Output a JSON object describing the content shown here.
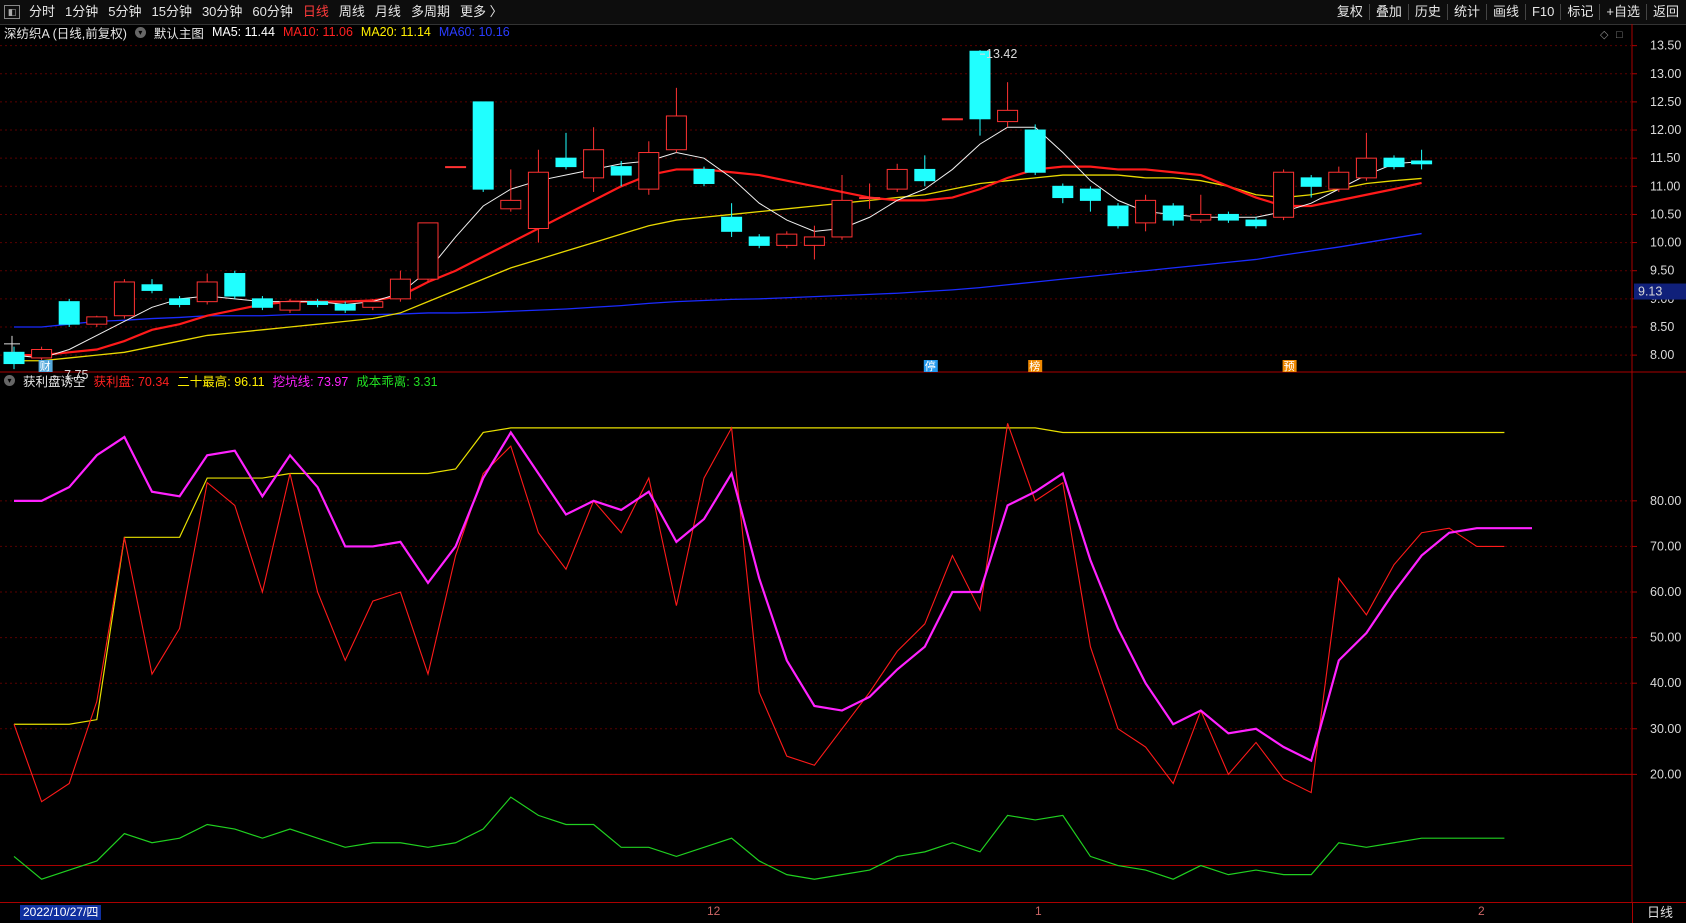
{
  "toolbar": {
    "left_items": [
      "分时",
      "1分钟",
      "5分钟",
      "15分钟",
      "30分钟",
      "60分钟",
      "日线",
      "周线",
      "月线",
      "多周期",
      "更多 〉"
    ],
    "active_item": "日线",
    "right_items": [
      "复权",
      "叠加",
      "历史",
      "统计",
      "画线",
      "F10",
      "标记",
      "+自选",
      "返回"
    ]
  },
  "main_pane": {
    "title": "深纺织A (日线,前复权)",
    "indicator_name": "默认主图",
    "ma": [
      {
        "label": "MA5: 11.44",
        "color": "#ffffff"
      },
      {
        "label": "MA10: 11.06",
        "color": "#ff2020"
      },
      {
        "label": "MA20: 11.14",
        "color": "#ffee00"
      },
      {
        "label": "MA60: 10.16",
        "color": "#2a3cff"
      }
    ],
    "y_ticks": [
      "13.50",
      "13.00",
      "12.50",
      "12.00",
      "11.50",
      "11.00",
      "10.50",
      "10.00",
      "9.50",
      "9.00",
      "8.50",
      "8.00"
    ],
    "price_tag": "9.13",
    "high_label": "13.42",
    "low_label": "7.75",
    "event_labels": [
      "财",
      "停",
      "榜",
      "预"
    ]
  },
  "indicator_pane": {
    "name": "获利盘诱空",
    "values": [
      {
        "label": "获利盘: 70.34",
        "color": "#ff2020"
      },
      {
        "label": "二十最高: 96.11",
        "color": "#ffee00"
      },
      {
        "label": "挖坑线: 73.97",
        "color": "#ff22ff"
      },
      {
        "label": "成本乖离: 3.31",
        "color": "#22dd22"
      }
    ],
    "y_ticks": [
      "80.00",
      "70.00",
      "60.00",
      "50.00",
      "40.00",
      "30.00",
      "20.00"
    ]
  },
  "bottom_axis": {
    "date_badge": "2022/10/27/四",
    "month_ticks": [
      "12",
      "1",
      "2"
    ],
    "period_label": "日线"
  },
  "candles": [
    {
      "o": 8.05,
      "c": 7.85,
      "h": 8.15,
      "l": 7.75
    },
    {
      "o": 7.95,
      "c": 8.1,
      "h": 8.15,
      "l": 7.9
    },
    {
      "o": 8.95,
      "c": 8.55,
      "h": 9.0,
      "l": 8.5
    },
    {
      "o": 8.55,
      "c": 8.68,
      "h": 8.7,
      "l": 8.5
    },
    {
      "o": 8.7,
      "c": 9.3,
      "h": 9.35,
      "l": 8.65
    },
    {
      "o": 9.25,
      "c": 9.15,
      "h": 9.35,
      "l": 9.1
    },
    {
      "o": 9.0,
      "c": 8.9,
      "h": 9.05,
      "l": 8.85
    },
    {
      "o": 8.95,
      "c": 9.3,
      "h": 9.45,
      "l": 8.9
    },
    {
      "o": 9.45,
      "c": 9.05,
      "h": 9.5,
      "l": 9.0
    },
    {
      "o": 9.0,
      "c": 8.85,
      "h": 9.05,
      "l": 8.8
    },
    {
      "o": 8.8,
      "c": 8.95,
      "h": 9.0,
      "l": 8.75
    },
    {
      "o": 8.95,
      "c": 8.9,
      "h": 9.0,
      "l": 8.85
    },
    {
      "o": 8.9,
      "c": 8.8,
      "h": 8.95,
      "l": 8.75
    },
    {
      "o": 8.85,
      "c": 8.95,
      "h": 9.0,
      "l": 8.8
    },
    {
      "o": 9.0,
      "c": 9.35,
      "h": 9.5,
      "l": 8.95
    },
    {
      "o": 9.35,
      "c": 10.35,
      "h": 10.35,
      "l": 9.3
    },
    {
      "o": 11.35,
      "c": 11.35,
      "h": 11.35,
      "l": 11.35
    },
    {
      "o": 12.5,
      "c": 10.95,
      "h": 12.5,
      "l": 10.9
    },
    {
      "o": 10.6,
      "c": 10.75,
      "h": 11.3,
      "l": 10.55
    },
    {
      "o": 10.25,
      "c": 11.25,
      "h": 11.65,
      "l": 10.0
    },
    {
      "o": 11.5,
      "c": 11.35,
      "h": 11.95,
      "l": 11.3
    },
    {
      "o": 11.15,
      "c": 11.65,
      "h": 12.05,
      "l": 10.9
    },
    {
      "o": 11.35,
      "c": 11.2,
      "h": 11.45,
      "l": 11.0
    },
    {
      "o": 10.95,
      "c": 11.6,
      "h": 11.8,
      "l": 10.85
    },
    {
      "o": 11.65,
      "c": 12.25,
      "h": 12.75,
      "l": 11.6
    },
    {
      "o": 11.3,
      "c": 11.05,
      "h": 11.35,
      "l": 11.0
    },
    {
      "o": 10.45,
      "c": 10.2,
      "h": 10.7,
      "l": 10.1
    },
    {
      "o": 10.1,
      "c": 9.95,
      "h": 10.15,
      "l": 9.9
    },
    {
      "o": 9.95,
      "c": 10.15,
      "h": 10.2,
      "l": 9.9
    },
    {
      "o": 9.95,
      "c": 10.1,
      "h": 10.3,
      "l": 9.7
    },
    {
      "o": 10.1,
      "c": 10.75,
      "h": 11.2,
      "l": 10.05
    },
    {
      "o": 10.8,
      "c": 10.8,
      "h": 11.05,
      "l": 10.6
    },
    {
      "o": 10.95,
      "c": 11.3,
      "h": 11.4,
      "l": 10.9
    },
    {
      "o": 11.3,
      "c": 11.1,
      "h": 11.55,
      "l": 11.0
    },
    {
      "o": 12.2,
      "c": 12.2,
      "h": 12.2,
      "l": 12.2
    },
    {
      "o": 13.4,
      "c": 12.2,
      "h": 13.42,
      "l": 11.9
    },
    {
      "o": 12.15,
      "c": 12.35,
      "h": 12.85,
      "l": 12.05
    },
    {
      "o": 12.0,
      "c": 11.25,
      "h": 12.1,
      "l": 11.2
    },
    {
      "o": 11.0,
      "c": 10.8,
      "h": 11.05,
      "l": 10.7
    },
    {
      "o": 10.95,
      "c": 10.75,
      "h": 11.0,
      "l": 10.55
    },
    {
      "o": 10.65,
      "c": 10.3,
      "h": 10.7,
      "l": 10.25
    },
    {
      "o": 10.35,
      "c": 10.75,
      "h": 10.85,
      "l": 10.2
    },
    {
      "o": 10.65,
      "c": 10.4,
      "h": 10.7,
      "l": 10.3
    },
    {
      "o": 10.4,
      "c": 10.5,
      "h": 10.85,
      "l": 10.35
    },
    {
      "o": 10.5,
      "c": 10.4,
      "h": 10.55,
      "l": 10.35
    },
    {
      "o": 10.4,
      "c": 10.3,
      "h": 10.45,
      "l": 10.25
    },
    {
      "o": 10.45,
      "c": 11.25,
      "h": 11.3,
      "l": 10.4
    },
    {
      "o": 11.15,
      "c": 11.0,
      "h": 11.2,
      "l": 10.8
    },
    {
      "o": 10.95,
      "c": 11.25,
      "h": 11.35,
      "l": 10.9
    },
    {
      "o": 11.15,
      "c": 11.5,
      "h": 11.95,
      "l": 11.1
    },
    {
      "o": 11.5,
      "c": 11.35,
      "h": 11.55,
      "l": 11.3
    },
    {
      "o": 11.45,
      "c": 11.4,
      "h": 11.65,
      "l": 11.3
    }
  ],
  "ma_lines": {
    "ma5": [
      8.0,
      7.95,
      8.1,
      8.35,
      8.6,
      8.85,
      9.0,
      9.05,
      9.0,
      8.95,
      8.95,
      8.95,
      8.9,
      8.95,
      9.1,
      9.5,
      10.1,
      10.65,
      10.95,
      11.1,
      11.2,
      11.3,
      11.4,
      11.45,
      11.6,
      11.5,
      11.15,
      10.7,
      10.4,
      10.2,
      10.25,
      10.45,
      10.75,
      10.95,
      11.3,
      11.75,
      12.05,
      12.05,
      11.6,
      11.1,
      10.75,
      10.55,
      10.5,
      10.45,
      10.45,
      10.45,
      10.55,
      10.7,
      10.95,
      11.2,
      11.4,
      11.44
    ],
    "ma10": [
      8.0,
      8.0,
      8.05,
      8.1,
      8.25,
      8.45,
      8.55,
      8.7,
      8.8,
      8.9,
      8.95,
      8.95,
      8.95,
      8.97,
      9.05,
      9.3,
      9.5,
      9.75,
      10.0,
      10.25,
      10.5,
      10.75,
      11.0,
      11.2,
      11.3,
      11.3,
      11.25,
      11.2,
      11.1,
      11.0,
      10.9,
      10.8,
      10.75,
      10.75,
      10.8,
      10.95,
      11.15,
      11.3,
      11.35,
      11.35,
      11.3,
      11.3,
      11.25,
      11.2,
      11.0,
      10.8,
      10.65,
      10.65,
      10.75,
      10.85,
      10.95,
      11.06
    ],
    "ma20": [
      7.9,
      7.9,
      7.95,
      8.0,
      8.05,
      8.15,
      8.25,
      8.35,
      8.4,
      8.45,
      8.5,
      8.55,
      8.6,
      8.65,
      8.75,
      8.95,
      9.15,
      9.35,
      9.55,
      9.7,
      9.85,
      10.0,
      10.15,
      10.3,
      10.4,
      10.45,
      10.5,
      10.55,
      10.6,
      10.65,
      10.7,
      10.75,
      10.8,
      10.85,
      10.95,
      11.05,
      11.1,
      11.15,
      11.2,
      11.2,
      11.2,
      11.15,
      11.15,
      11.1,
      11.0,
      10.85,
      10.8,
      10.85,
      10.95,
      11.05,
      11.1,
      11.14
    ],
    "ma60": [
      8.5,
      8.5,
      8.55,
      8.6,
      8.62,
      8.65,
      8.67,
      8.7,
      8.7,
      8.7,
      8.72,
      8.72,
      8.72,
      8.72,
      8.73,
      8.75,
      8.75,
      8.76,
      8.78,
      8.8,
      8.82,
      8.85,
      8.88,
      8.92,
      8.95,
      8.97,
      8.99,
      9.0,
      9.02,
      9.04,
      9.06,
      9.08,
      9.1,
      9.13,
      9.16,
      9.2,
      9.25,
      9.3,
      9.35,
      9.4,
      9.45,
      9.5,
      9.55,
      9.6,
      9.65,
      9.7,
      9.78,
      9.85,
      9.92,
      10.0,
      10.08,
      10.16
    ]
  },
  "indicator_series": {
    "profit": [
      31,
      14,
      18,
      36,
      72,
      42,
      52,
      84,
      79,
      60,
      86,
      60,
      45,
      58,
      60,
      42,
      68,
      86,
      92,
      73,
      65,
      80,
      73,
      85,
      57,
      85,
      96,
      38,
      24,
      22,
      30,
      38,
      47,
      53,
      68,
      56,
      97,
      80,
      84,
      48,
      30,
      26,
      18,
      34,
      20,
      27,
      19,
      16,
      63,
      55,
      66,
      73,
      74,
      70,
      70
    ],
    "twenty_high": [
      31,
      31,
      31,
      32,
      72,
      72,
      72,
      85,
      85,
      85,
      86,
      86,
      86,
      86,
      86,
      86,
      87,
      95,
      96,
      96,
      96,
      96,
      96,
      96,
      96,
      96,
      96,
      96,
      96,
      96,
      96,
      96,
      96,
      96,
      96,
      96,
      96,
      96,
      95,
      95,
      95,
      95,
      95,
      95,
      95,
      95,
      95,
      95,
      95,
      95,
      95,
      95,
      95,
      95,
      95
    ],
    "pit": [
      80,
      80,
      83,
      90,
      94,
      82,
      81,
      90,
      91,
      81,
      90,
      83,
      70,
      70,
      71,
      62,
      70,
      85,
      95,
      86,
      77,
      80,
      78,
      82,
      71,
      76,
      86,
      63,
      45,
      35,
      34,
      37,
      43,
      48,
      60,
      60,
      79,
      82,
      86,
      67,
      52,
      40,
      31,
      34,
      29,
      30,
      26,
      23,
      45,
      51,
      60,
      68,
      73,
      74,
      74,
      74
    ],
    "cost": [
      2,
      -3,
      -1,
      1,
      7,
      5,
      6,
      9,
      8,
      6,
      8,
      6,
      4,
      5,
      5,
      4,
      5,
      8,
      15,
      11,
      9,
      9,
      4,
      4,
      2,
      4,
      6,
      1,
      -2,
      -3,
      -2,
      -1,
      2,
      3,
      5,
      3,
      11,
      10,
      11,
      2,
      0,
      -1,
      -3,
      0,
      -2,
      -1,
      -2,
      -2,
      5,
      4,
      5,
      6,
      6,
      6,
      6
    ]
  }
}
